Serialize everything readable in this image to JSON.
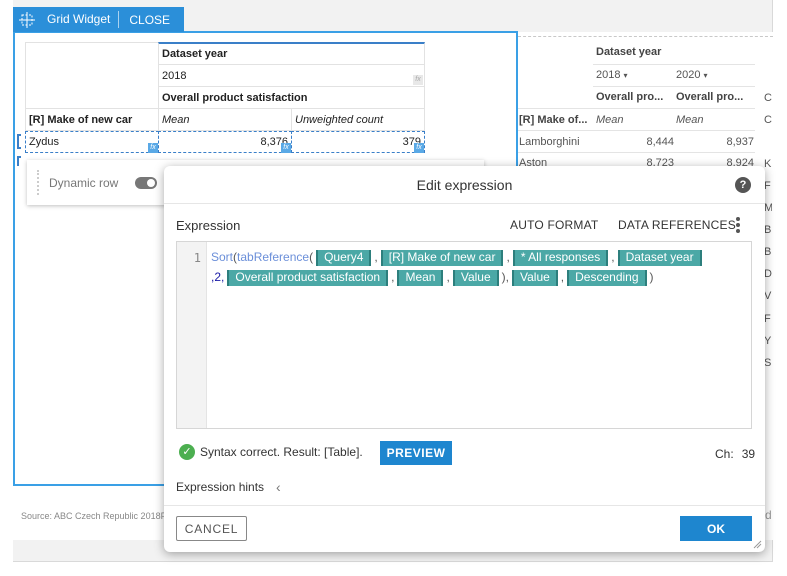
{
  "widget": {
    "title": "Grid Widget",
    "close_label": "CLOSE",
    "grid": {
      "header1": "Dataset year",
      "year": "2018",
      "header2": "Overall product satisfaction",
      "row_header": "[R] Make of new car",
      "col_mean": "Mean",
      "col_count": "Unweighted count",
      "row_label": "Zydus",
      "row_mean": "8,376",
      "row_count": "379"
    },
    "dynamic_row_label": "Dynamic row",
    "source_text": "Source: ABC Czech Republic 2018F"
  },
  "background_table": {
    "header_dataset_year": "Dataset year",
    "year_1": "2018",
    "year_2": "2020",
    "sub_1": "Overall pro...",
    "sub_2": "Overall pro...",
    "make_header": "[R] Make of...",
    "mean_1": "Mean",
    "mean_2": "Mean",
    "rows": [
      {
        "label": "Lamborghini",
        "v1": "8,444",
        "v2": "8,937"
      },
      {
        "label": "Aston",
        "v1": "8,723",
        "v2": "8,924"
      }
    ],
    "edge_letters": [
      "C",
      "C",
      "K",
      "F",
      "M",
      "B",
      "B",
      "D",
      "V",
      "F",
      "Y",
      "S"
    ],
    "edge_tail": "d"
  },
  "dialog": {
    "title": "Edit expression",
    "help_glyph": "?",
    "expression_label": "Expression",
    "auto_format": "AUTO FORMAT",
    "data_references": "DATA REFERENCES",
    "line_number": "1",
    "code": {
      "fn1": "Sort",
      "fn2": "tabReference",
      "t1": "Query4",
      "t2": "[R] Make of new car",
      "t3": "* All responses",
      "t4": "Dataset year",
      "num": "2",
      "t5": "Overall product satisfaction",
      "t6": "Mean",
      "t7": "Value",
      "t8": "Value",
      "t9": "Descending"
    },
    "status_text": "Syntax correct. Result: [Table].",
    "preview_label": "PREVIEW",
    "ch_label": "Ch:",
    "ch_value": "39",
    "hints_label": "Expression hints",
    "cancel_label": "CANCEL",
    "ok_label": "OK"
  }
}
